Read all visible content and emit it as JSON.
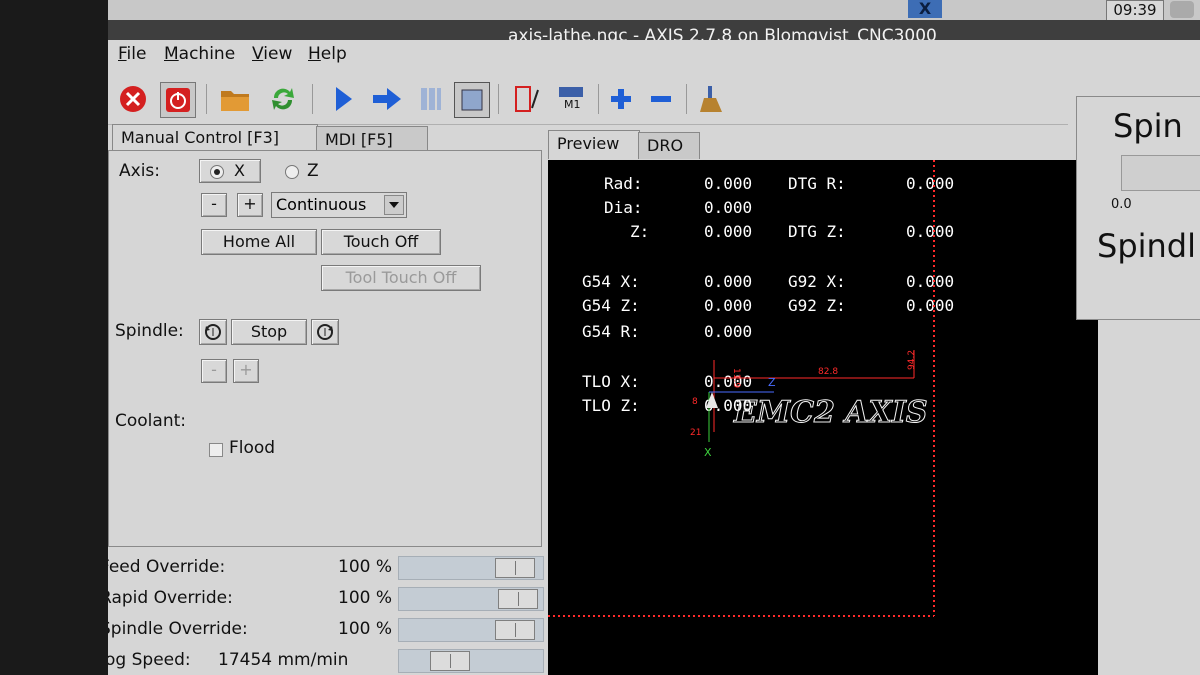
{
  "taskbar": {
    "x_icon_label": "X",
    "clock": "09:39"
  },
  "window": {
    "title": "axis-lathe.ngc - AXIS 2.7.8 on Blomqvist_CNC3000"
  },
  "menu": [
    "File",
    "Machine",
    "View",
    "Help"
  ],
  "toolbar": {
    "m1_label": "M1"
  },
  "left_tabs": [
    "Manual Control [F3]",
    "MDI [F5]"
  ],
  "manual": {
    "axis_label": "Axis:",
    "axis_x": "X",
    "axis_z": "Z",
    "minus": "-",
    "plus": "+",
    "jog_mode": "Continuous",
    "home_all": "Home All",
    "touch_off": "Touch Off",
    "tool_touch_off": "Tool Touch Off",
    "spindle_label": "Spindle:",
    "spindle_stop": "Stop",
    "coolant_label": "Coolant:",
    "flood": "Flood"
  },
  "overrides": [
    {
      "label": "Feed Override:",
      "value": "100 %",
      "level": 0.92
    },
    {
      "label": "Rapid Override:",
      "value": "100 %",
      "level": 0.95
    },
    {
      "label": "Spindle Override:",
      "value": "100 %",
      "level": 0.92
    },
    {
      "label": "Jog Speed:",
      "value": "17454 mm/min",
      "level": 0.3
    }
  ],
  "preview_tabs": [
    "Preview",
    "DRO"
  ],
  "dro": {
    "rows": [
      {
        "label": "Rad:",
        "value": "0.000",
        "label2": "DTG R:",
        "value2": "0.000"
      },
      {
        "label": "Dia:",
        "value": "0.000",
        "label2": "",
        "value2": ""
      },
      {
        "label": "Z:",
        "value": "0.000",
        "label2": "DTG Z:",
        "value2": "0.000"
      },
      {
        "label": "G54 X:",
        "value": "0.000",
        "label2": "G92 X:",
        "value2": "0.000"
      },
      {
        "label": "G54 Z:",
        "value": "0.000",
        "label2": "G92 Z:",
        "value2": "0.000"
      },
      {
        "label": "G54 R:",
        "value": "0.000",
        "label2": "",
        "value2": ""
      },
      {
        "label": "TLO X:",
        "value": "0.000",
        "label2": "",
        "value2": ""
      },
      {
        "label": "TLO Z:",
        "value": "0.000",
        "label2": "",
        "value2": ""
      }
    ]
  },
  "preview": {
    "logo_text": "EMC2 AXIS",
    "dim_z": "82.8",
    "dim_right": "94.2",
    "dim_left": "11.9",
    "dim_small1": "8",
    "dim_small2": "21",
    "axis_x": "X",
    "axis_z": "Z"
  },
  "spindle_panel": {
    "title": "Spin",
    "value": "0.0",
    "label": "Spindl"
  },
  "colors": {
    "preview_bg": "#000000",
    "dimension_red": "#ff2a2a",
    "axis_green": "#3dd13d",
    "axis_blue": "#4a6cff"
  }
}
